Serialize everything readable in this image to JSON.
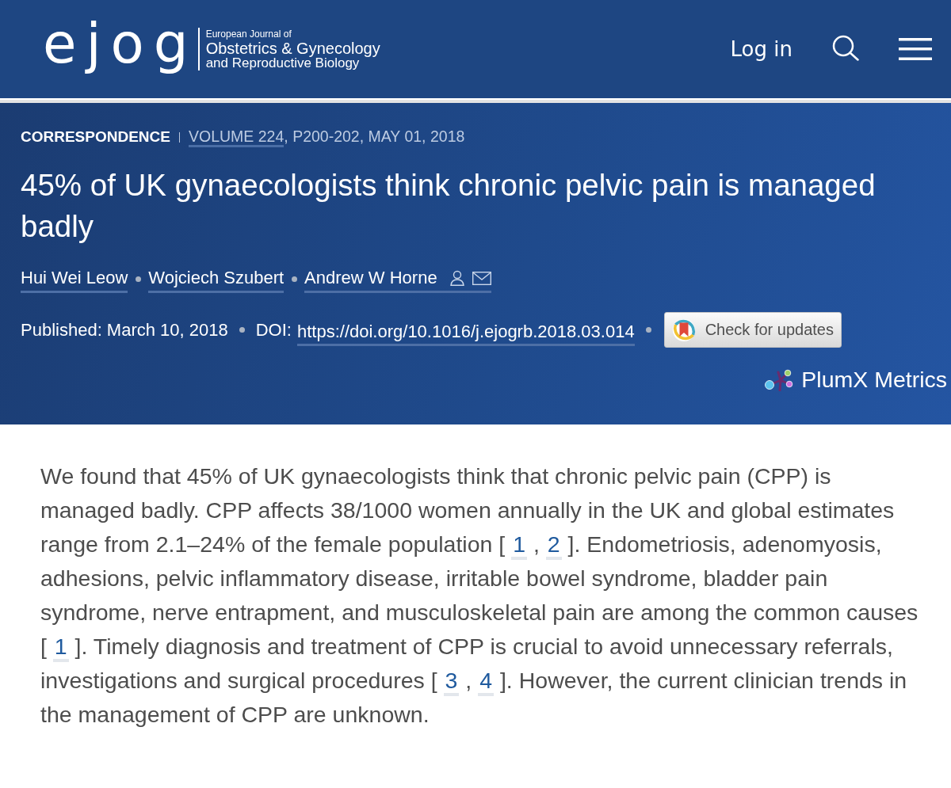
{
  "header": {
    "logo": "ejog",
    "journal_name": [
      "European Journal of",
      "Obstetrics & Gynecology",
      "and Reproductive Biology"
    ],
    "login": "Log in"
  },
  "article": {
    "type": "CORRESPONDENCE",
    "volume": "VOLUME 224",
    "issue_details": ", P200-202, MAY 01, 2018",
    "title": "45% of UK gynaecologists think chronic pelvic pain is managed badly",
    "authors": [
      {
        "name": "Hui Wei Leow",
        "corresponding": false
      },
      {
        "name": "Wojciech Szubert",
        "corresponding": false
      },
      {
        "name": "Andrew W Horne",
        "corresponding": true
      }
    ],
    "published": "Published: March 10, 2018",
    "doi_label": "DOI:",
    "doi": "https://doi.org/10.1016/j.ejogrb.2018.03.014",
    "updates_button": "Check for updates",
    "metrics": "PlumX Metrics"
  },
  "abstract": {
    "segments": [
      {
        "kind": "text",
        "text": "We found that 45% of UK gynaecologists think that chronic pelvic pain (CPP) is managed badly. CPP affects 38/1000 women annually in the UK and global estimates range from 2.1–24% of the female population [ "
      },
      {
        "kind": "reference",
        "text": "1"
      },
      {
        "kind": "text",
        "text": " , "
      },
      {
        "kind": "reference",
        "text": "2"
      },
      {
        "kind": "text",
        "text": " ]. Endometriosis, adenomyosis, adhesions, pelvic inflammatory disease, irritable bowel syndrome, bladder pain syndrome, nerve entrapment, and musculoskeletal pain are among the common causes [ "
      },
      {
        "kind": "reference",
        "text": "1"
      },
      {
        "kind": "text",
        "text": " ]. Timely diagnosis and treatment of CPP is crucial to avoid unnecessary referrals, investigations and surgical procedures [ "
      },
      {
        "kind": "reference",
        "text": "3"
      },
      {
        "kind": "text",
        "text": " , "
      },
      {
        "kind": "reference",
        "text": "4"
      },
      {
        "kind": "text",
        "text": " ]. However, the current clinician trends in the management of CPP are unknown."
      }
    ]
  }
}
